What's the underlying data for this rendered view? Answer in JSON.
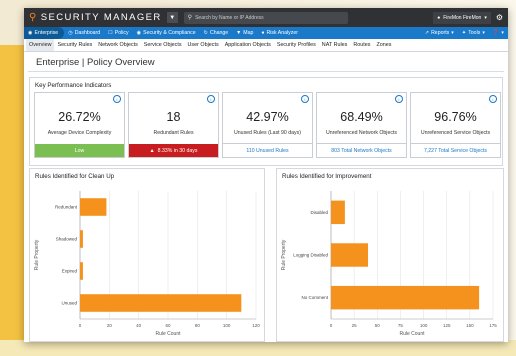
{
  "app": {
    "brand": "SECURITY MANAGER",
    "search_placeholder": "Search by Name or IP Address",
    "user": "FireMon FireMon"
  },
  "nav": {
    "items": [
      "Enterprise",
      "Dashboard",
      "Policy",
      "Security & Compliance",
      "Change",
      "Map",
      "Risk Analyzer"
    ],
    "right": [
      "Reports",
      "Tools"
    ]
  },
  "subnav": [
    "Overview",
    "Security Rules",
    "Network Objects",
    "Service Objects",
    "User Objects",
    "Application Objects",
    "Security Profiles",
    "NAT Rules",
    "Routes",
    "Zones"
  ],
  "page_title": "Enterprise | Policy Overview",
  "kpi_title": "Key Performance Indicators",
  "kpis": [
    {
      "value": "26.72%",
      "label": "Average Device Complexity",
      "footer": "Low",
      "footer_color": "#7bbf52"
    },
    {
      "value": "18",
      "label": "Redundant Rules",
      "footer": "8.33% in 30 days",
      "footer_color": "#c71d20"
    },
    {
      "value": "42.97%",
      "label": "Unused Rules (Last 90 days)",
      "footer": "110 Unused Rules"
    },
    {
      "value": "68.49%",
      "label": "Unreferenced Network Objects",
      "footer": "803 Total Network Objects"
    },
    {
      "value": "96.76%",
      "label": "Unreferenced Service Objects",
      "footer": "7,227 Total Service Objects"
    }
  ],
  "colors": {
    "accent": "#1a79c8",
    "bar": "#f5921e",
    "topbar": "#2f3135"
  },
  "chart_data": [
    {
      "type": "bar",
      "orientation": "horizontal",
      "title": "Rules Identified for Clean Up",
      "categories": [
        "Redundant",
        "Shadowed",
        "Expired",
        "Unused"
      ],
      "values": [
        18,
        2,
        2,
        110
      ],
      "xlabel": "Rule Count",
      "ylabel": "Rule Property",
      "xlim": [
        0,
        120
      ],
      "xticks": [
        0,
        20,
        40,
        60,
        80,
        100,
        120
      ],
      "grid": true
    },
    {
      "type": "bar",
      "orientation": "horizontal",
      "title": "Rules Identified for Improvement",
      "categories": [
        "Disabled",
        "Logging Disabled",
        "No Comment"
      ],
      "values": [
        15,
        40,
        160
      ],
      "xlabel": "Rule Count",
      "ylabel": "Rule Property",
      "xlim": [
        0,
        175
      ],
      "xticks": [
        0,
        25,
        50,
        75,
        100,
        125,
        150,
        175
      ],
      "grid": true
    }
  ]
}
